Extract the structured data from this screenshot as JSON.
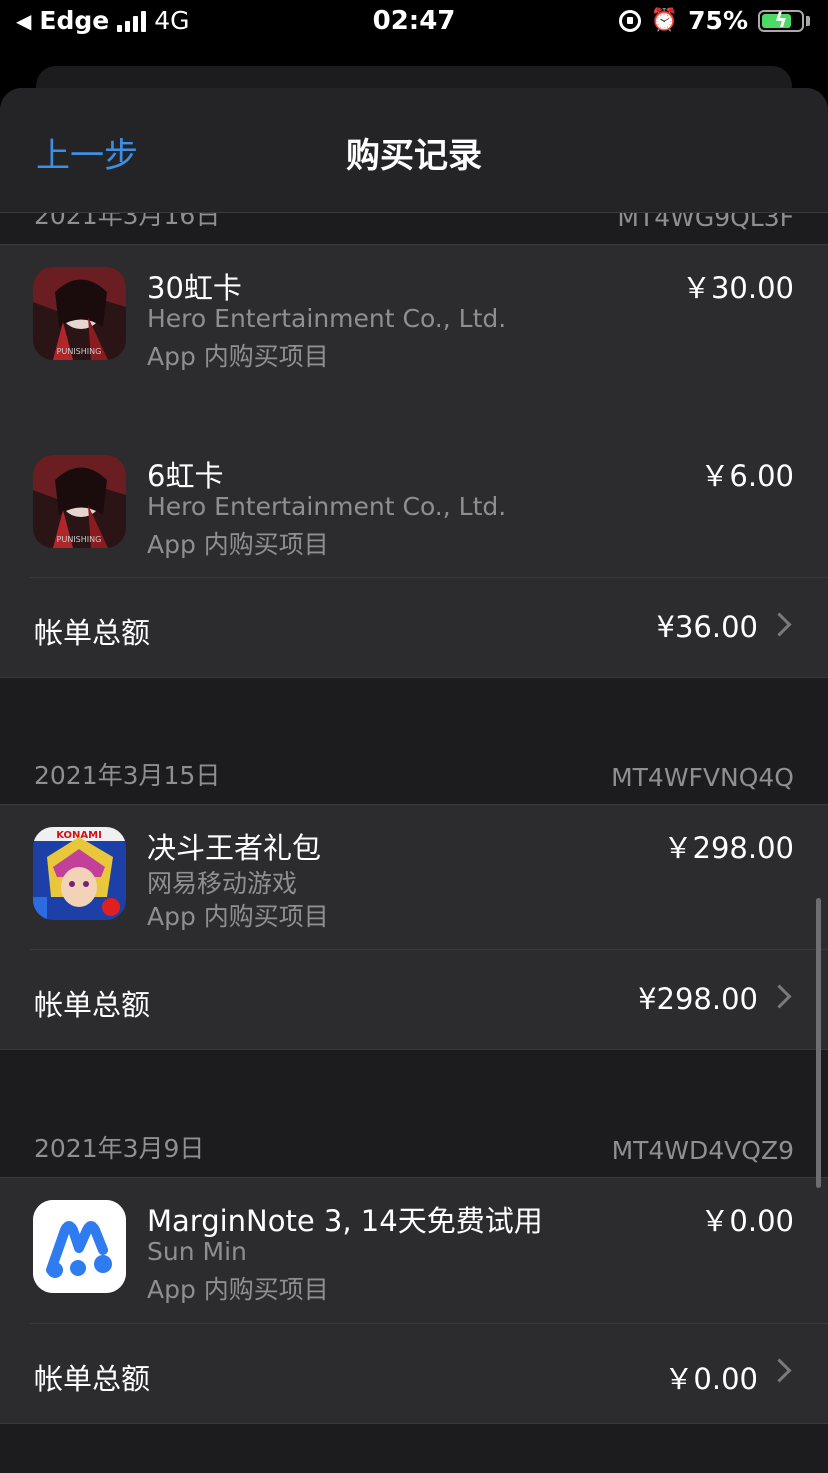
{
  "status_bar": {
    "carrier": "Edge",
    "network": "4G",
    "time": "02:47",
    "battery": "75%",
    "battery_level": 0.75,
    "battery_color": "#4cd964"
  },
  "nav": {
    "back_label": "上一步",
    "title": "购买记录",
    "accent": "#3d8fe6"
  },
  "sections": [
    {
      "date": "2021年3月16日",
      "order_id": "MT4WG9QL3F",
      "items": [
        {
          "icon": "punishing-app-icon",
          "title": "30虹卡",
          "developer": "Hero Entertainment Co., Ltd.",
          "type": "App 内购买项目",
          "price": "￥30.00"
        },
        {
          "icon": "punishing-app-icon",
          "title": "6虹卡",
          "developer": "Hero Entertainment Co., Ltd.",
          "type": "App 内购买项目",
          "price": "￥6.00"
        }
      ],
      "total_label": "帐单总额",
      "total": "¥36.00"
    },
    {
      "date": "2021年3月15日",
      "order_id": "MT4WFVNQ4Q",
      "items": [
        {
          "icon": "duel-links-app-icon",
          "title": "决斗王者礼包",
          "developer": "网易移动游戏",
          "type": "App 内购买项目",
          "price": "￥298.00"
        }
      ],
      "total_label": "帐单总额",
      "total": "¥298.00"
    },
    {
      "date": "2021年3月9日",
      "order_id": "MT4WD4VQZ9",
      "items": [
        {
          "icon": "marginnote-app-icon",
          "title": "MarginNote 3, 14天免费试用",
          "developer": "Sun Min",
          "type": "App 内购买项目",
          "price": "￥0.00"
        }
      ],
      "total_label": "帐单总额",
      "total": "￥0.00"
    }
  ]
}
